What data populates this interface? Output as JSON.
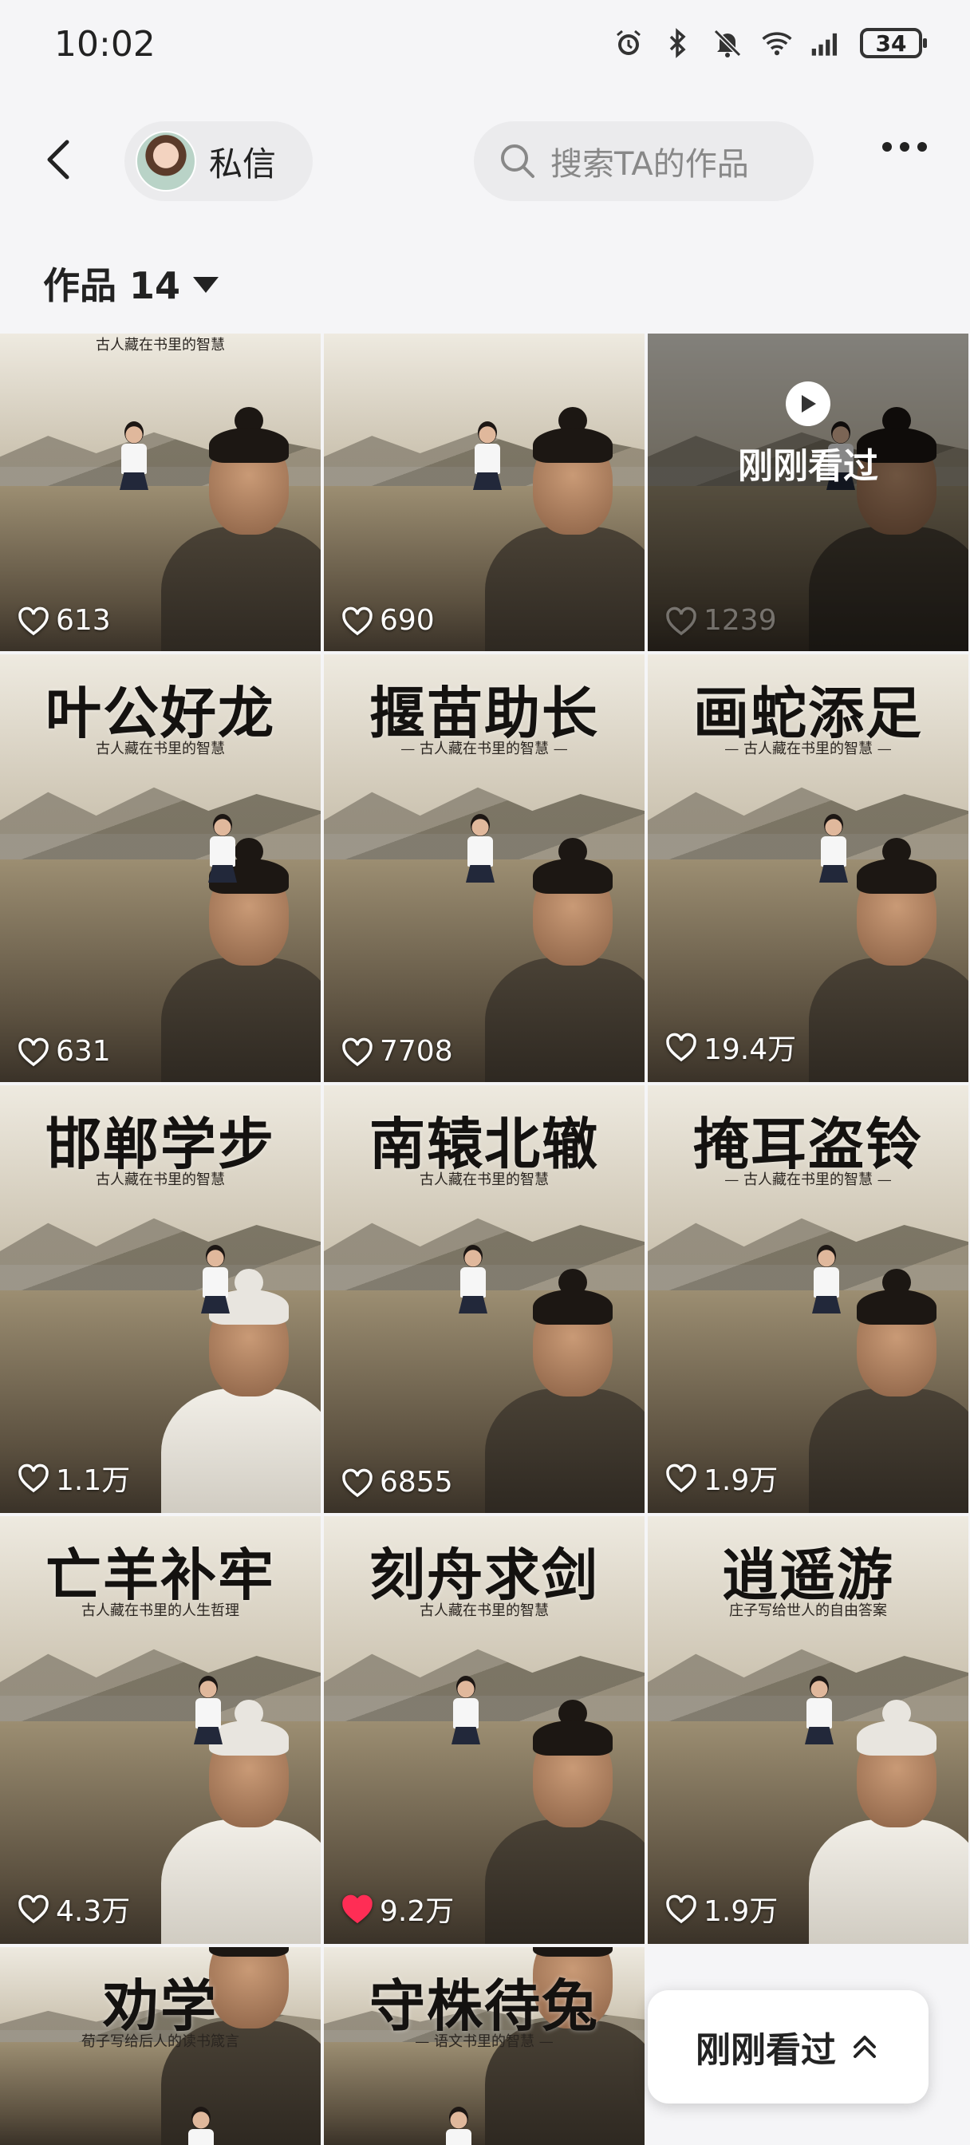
{
  "status_bar": {
    "time": "10:02",
    "battery": "34",
    "icons": [
      "alarm-icon",
      "bluetooth-icon",
      "mute-icon",
      "wifi-icon",
      "signal-icon"
    ]
  },
  "header": {
    "dm_label": "私信",
    "search_placeholder": "搜索TA的作品"
  },
  "works": {
    "label": "作品 14"
  },
  "tiles": [
    {
      "title": "",
      "subtitle": "古人藏在书里的智慧",
      "likes": "613",
      "liked": false,
      "watched": false
    },
    {
      "title": "",
      "subtitle": "",
      "likes": "690",
      "liked": false,
      "watched": false
    },
    {
      "title": "",
      "subtitle": "",
      "likes": "1239",
      "liked": false,
      "watched": true,
      "watched_label": "刚刚看过"
    },
    {
      "title": "叶公好龙",
      "subtitle": "古人藏在书里的智慧",
      "likes": "631",
      "liked": false,
      "watched": false
    },
    {
      "title": "揠苗助长",
      "subtitle": "— 古人藏在书里的智慧 —",
      "likes": "7708",
      "liked": false,
      "watched": false
    },
    {
      "title": "画蛇添足",
      "subtitle": "— 古人藏在书里的智慧 —",
      "likes": "19.4万",
      "liked": false,
      "watched": false
    },
    {
      "title": "邯郸学步",
      "subtitle": "古人藏在书里的智慧",
      "likes": "1.1万",
      "liked": false,
      "watched": false
    },
    {
      "title": "南辕北辙",
      "subtitle": "古人藏在书里的智慧",
      "likes": "6855",
      "liked": false,
      "watched": false
    },
    {
      "title": "掩耳盗铃",
      "subtitle": "— 古人藏在书里的智慧 —",
      "likes": "1.9万",
      "liked": false,
      "watched": false
    },
    {
      "title": "亡羊补牢",
      "subtitle": "古人藏在书里的人生哲理",
      "likes": "4.3万",
      "liked": false,
      "watched": false
    },
    {
      "title": "刻舟求剑",
      "subtitle": "古人藏在书里的智慧",
      "likes": "9.2万",
      "liked": true,
      "watched": false
    },
    {
      "title": "逍遥游",
      "subtitle": "庄子写给世人的自由答案",
      "likes": "1.9万",
      "liked": false,
      "watched": false
    },
    {
      "title": "劝学",
      "subtitle": "荀子写给后人的读书箴言",
      "likes": "",
      "liked": false,
      "watched": false
    },
    {
      "title": "守株待兔",
      "subtitle": "— 语文书里的智慧 —",
      "likes": "",
      "liked": false,
      "watched": false
    }
  ],
  "recent_button": {
    "label": "刚刚看过"
  },
  "colors": {
    "background": "#f5f5f7",
    "liked_heart": "#ff2d55",
    "pill": "#ebebed"
  }
}
